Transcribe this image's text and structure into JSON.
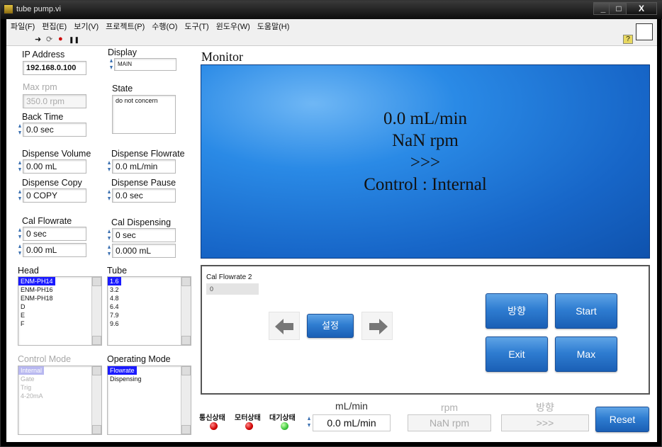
{
  "window": {
    "title": "tube pump.vi",
    "min_label": "_",
    "max_label": "□",
    "close_label": "X"
  },
  "menu": [
    "파일(F)",
    "편집(E)",
    "보기(V)",
    "프로젝트(P)",
    "수행(O)",
    "도구(T)",
    "윈도우(W)",
    "도움말(H)"
  ],
  "toolbar": {
    "run": "➜",
    "run_cont": "⟳",
    "abort": "●",
    "pause": "❚❚",
    "help": "?"
  },
  "left": {
    "ip_label": "IP Address",
    "ip_value": "192.168.0.100",
    "display_label": "Display",
    "display_value": "MAIN",
    "max_rpm_label": "Max rpm",
    "max_rpm_value": "350.0 rpm",
    "state_label": "State",
    "state_value": "do not concern",
    "back_time_label": "Back Time",
    "back_time_value": "0.0 sec",
    "dispense_volume_label": "Dispense Volume",
    "dispense_volume_value": "0.00 mL",
    "dispense_flowrate_label": "Dispense Flowrate",
    "dispense_flowrate_value": "0.0 mL/min",
    "dispense_copy_label": "Dispense Copy",
    "dispense_copy_value": "0 COPY",
    "dispense_pause_label": "Dispense Pause",
    "dispense_pause_value": "0.0 sec",
    "cal_flowrate_label": "Cal Flowrate",
    "cal_flowrate_sec": "0 sec",
    "cal_flowrate_ml": "0.00 mL",
    "cal_dispensing_label": "Cal Dispensing",
    "cal_dispensing_sec": "0 sec",
    "cal_dispensing_ml": "0.000 mL",
    "head_label": "Head",
    "head_items": [
      "ENM-PH14",
      "ENM-PH16",
      "ENM-PH18",
      "D",
      "E",
      "F"
    ],
    "tube_label": "Tube",
    "tube_items": [
      "1.6",
      "3.2",
      "4.8",
      "6.4",
      "7.9",
      "9.6"
    ],
    "control_mode_label": "Control Mode",
    "control_mode_items": [
      "Internal",
      "Gate",
      "Trig",
      "4-20mA"
    ],
    "operating_mode_label": "Operating Mode",
    "operating_mode_items": [
      "Flowrate",
      "Dispensing"
    ]
  },
  "monitor": {
    "title": "Monitor",
    "line1": "0.0 mL/min",
    "line2": "NaN rpm",
    "line3": ">>>",
    "line4": "Control : Internal"
  },
  "control": {
    "cal_flowrate2_label": "Cal Flowrate 2",
    "cal_flowrate2_value": "0",
    "set_label": "설정",
    "direction_label": "방향",
    "start_label": "Start",
    "exit_label": "Exit",
    "max_label": "Max"
  },
  "status": {
    "comm_label": "통신상태",
    "motor_label": "모터상태",
    "standby_label": "대기상태",
    "comm_color": "#d00000",
    "motor_color": "#d00000",
    "standby_color": "#3cc83c",
    "flow_header": "mL/min",
    "flow_value": "0.0 mL/min",
    "rpm_header": "rpm",
    "rpm_value": "NaN rpm",
    "dir_header": "방향",
    "dir_value": ">>>",
    "reset_label": "Reset"
  }
}
